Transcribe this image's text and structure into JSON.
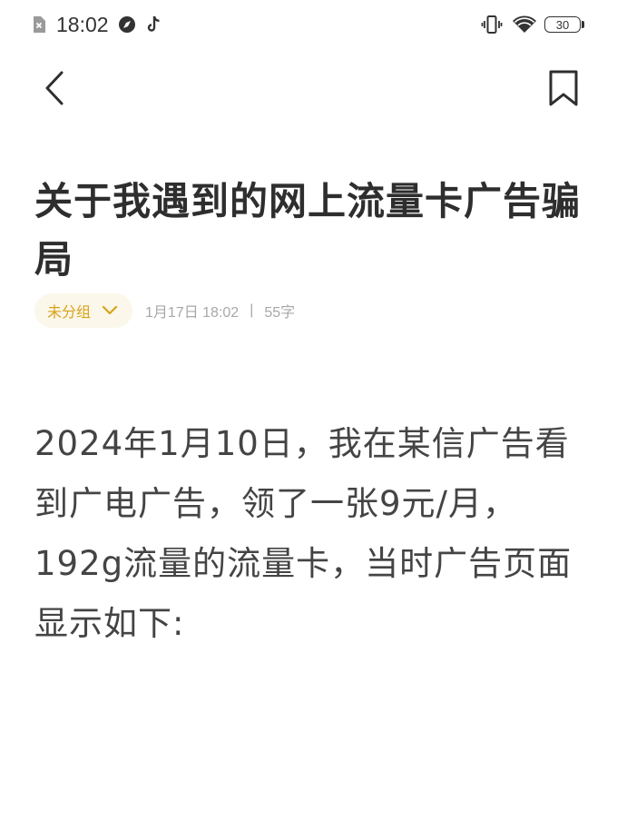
{
  "status_bar": {
    "time": "18:02",
    "battery": "30",
    "icons": [
      "sim-off-icon",
      "compass-icon",
      "tiktok-icon",
      "vibrate-icon",
      "wifi-icon",
      "battery-icon"
    ]
  },
  "nav": {
    "back_icon": "chevron-left-icon",
    "bookmark_icon": "bookmark-icon"
  },
  "article": {
    "title": "关于我遇到的网上流量卡广告骗局",
    "group": "未分组",
    "date": "1月17日 18:02",
    "separator": "|",
    "word_count": "55字",
    "body": "2024年1月10日，我在某信广告看到广电广告，领了一张9元/月，192g流量的流量卡，当时广告页面显示如下:"
  },
  "colors": {
    "accent": "#d9a31a",
    "chip_bg": "#fbf7ea",
    "text": "#333333",
    "meta": "#a8a8a8"
  }
}
